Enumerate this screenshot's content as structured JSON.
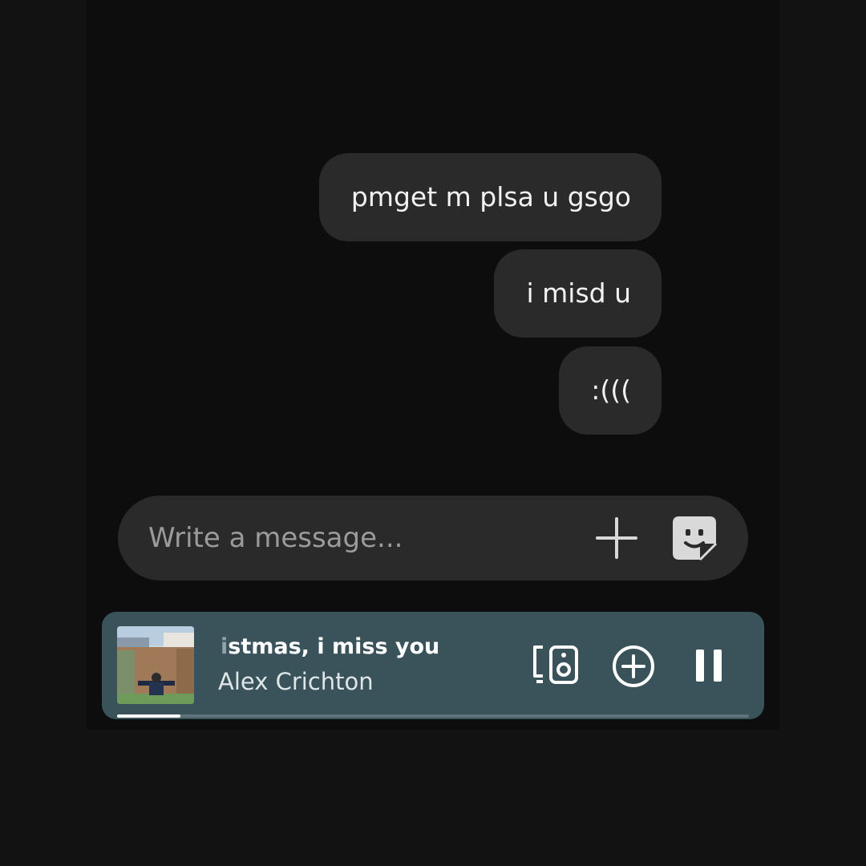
{
  "messages": [
    {
      "text": "pmget m plsa u gsgo"
    },
    {
      "text": "i misd u"
    },
    {
      "text": ":((("
    }
  ],
  "composer": {
    "placeholder": "Write a message...",
    "add_icon": "plus-icon",
    "sticker_icon": "sticker-icon"
  },
  "player": {
    "title_faded_prefix": "i",
    "title_rest": "stmas, i miss you",
    "artist": "Alex Crichton",
    "progress": 0.1,
    "icons": [
      "devices-icon",
      "add-circle-icon",
      "pause-icon"
    ],
    "background_color": "#3a5259"
  }
}
